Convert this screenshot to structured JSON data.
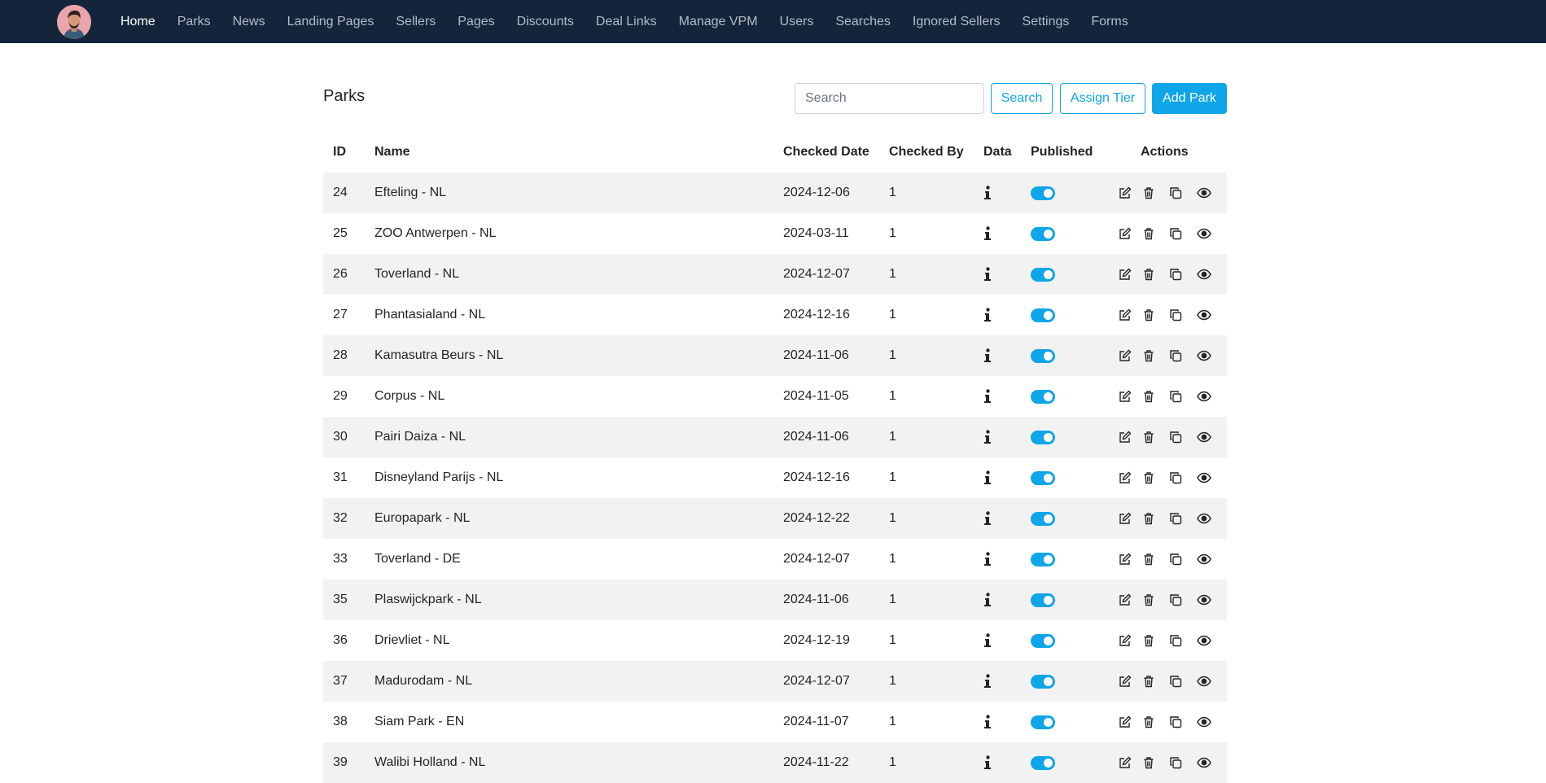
{
  "nav": {
    "items": [
      {
        "label": "Home",
        "active": true
      },
      {
        "label": "Parks"
      },
      {
        "label": "News"
      },
      {
        "label": "Landing Pages"
      },
      {
        "label": "Sellers"
      },
      {
        "label": "Pages"
      },
      {
        "label": "Discounts"
      },
      {
        "label": "Deal Links"
      },
      {
        "label": "Manage VPM"
      },
      {
        "label": "Users"
      },
      {
        "label": "Searches"
      },
      {
        "label": "Ignored Sellers"
      },
      {
        "label": "Settings"
      },
      {
        "label": "Forms"
      }
    ]
  },
  "page": {
    "title": "Parks",
    "search_placeholder": "Search",
    "search_button": "Search",
    "assign_tier_button": "Assign Tier",
    "add_park_button": "Add Park"
  },
  "table": {
    "headers": {
      "id": "ID",
      "name": "Name",
      "checked_date": "Checked Date",
      "checked_by": "Checked By",
      "data": "Data",
      "published": "Published",
      "actions": "Actions"
    },
    "rows": [
      {
        "id": "24",
        "name": "Efteling - NL",
        "checked_date": "2024-12-06",
        "checked_by": "1",
        "published": true
      },
      {
        "id": "25",
        "name": "ZOO Antwerpen - NL",
        "checked_date": "2024-03-11",
        "checked_by": "1",
        "published": true
      },
      {
        "id": "26",
        "name": "Toverland - NL",
        "checked_date": "2024-12-07",
        "checked_by": "1",
        "published": true
      },
      {
        "id": "27",
        "name": "Phantasialand - NL",
        "checked_date": "2024-12-16",
        "checked_by": "1",
        "published": true
      },
      {
        "id": "28",
        "name": "Kamasutra Beurs - NL",
        "checked_date": "2024-11-06",
        "checked_by": "1",
        "published": true
      },
      {
        "id": "29",
        "name": "Corpus - NL",
        "checked_date": "2024-11-05",
        "checked_by": "1",
        "published": true
      },
      {
        "id": "30",
        "name": "Pairi Daiza - NL",
        "checked_date": "2024-11-06",
        "checked_by": "1",
        "published": true
      },
      {
        "id": "31",
        "name": "Disneyland Parijs - NL",
        "checked_date": "2024-12-16",
        "checked_by": "1",
        "published": true
      },
      {
        "id": "32",
        "name": "Europapark - NL",
        "checked_date": "2024-12-22",
        "checked_by": "1",
        "published": true
      },
      {
        "id": "33",
        "name": "Toverland - DE",
        "checked_date": "2024-12-07",
        "checked_by": "1",
        "published": true
      },
      {
        "id": "35",
        "name": "Plaswijckpark - NL",
        "checked_date": "2024-11-06",
        "checked_by": "1",
        "published": true
      },
      {
        "id": "36",
        "name": "Drievliet - NL",
        "checked_date": "2024-12-19",
        "checked_by": "1",
        "published": true
      },
      {
        "id": "37",
        "name": "Madurodam - NL",
        "checked_date": "2024-12-07",
        "checked_by": "1",
        "published": true
      },
      {
        "id": "38",
        "name": "Siam Park - EN",
        "checked_date": "2024-11-07",
        "checked_by": "1",
        "published": true
      },
      {
        "id": "39",
        "name": "Walibi Holland - NL",
        "checked_date": "2024-11-22",
        "checked_by": "1",
        "published": true
      }
    ]
  },
  "icons": {
    "info": "info-icon",
    "edit": "edit-icon",
    "delete": "trash-icon",
    "copy": "copy-icon",
    "view": "eye-icon"
  },
  "colors": {
    "navbar": "#13243b",
    "accent": "#0ea5e9",
    "stripe": "#f2f2f2"
  }
}
